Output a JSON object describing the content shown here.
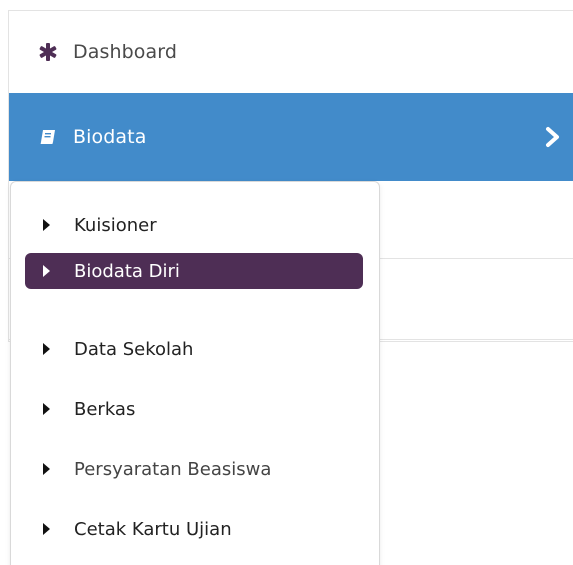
{
  "sidebar": {
    "dashboard": {
      "label": "Dashboard",
      "icon": "asterisk-icon"
    },
    "biodata": {
      "label": "Biodata",
      "icon": "book-icon",
      "expand_icon": "chevron-right-icon"
    },
    "submenu": [
      {
        "label": "Kuisioner",
        "active": false
      },
      {
        "label": "Biodata Diri",
        "active": true
      },
      {
        "label": "Data Sekolah",
        "active": false
      },
      {
        "label": "Berkas",
        "active": false
      },
      {
        "label": "Persyaratan Beasiswa",
        "active": false
      },
      {
        "label": "Cetak Kartu Ujian",
        "active": false
      }
    ]
  },
  "colors": {
    "active_blue": "#428bca",
    "active_purple": "#4e2e55",
    "dashboard_icon": "#4e2e55"
  }
}
